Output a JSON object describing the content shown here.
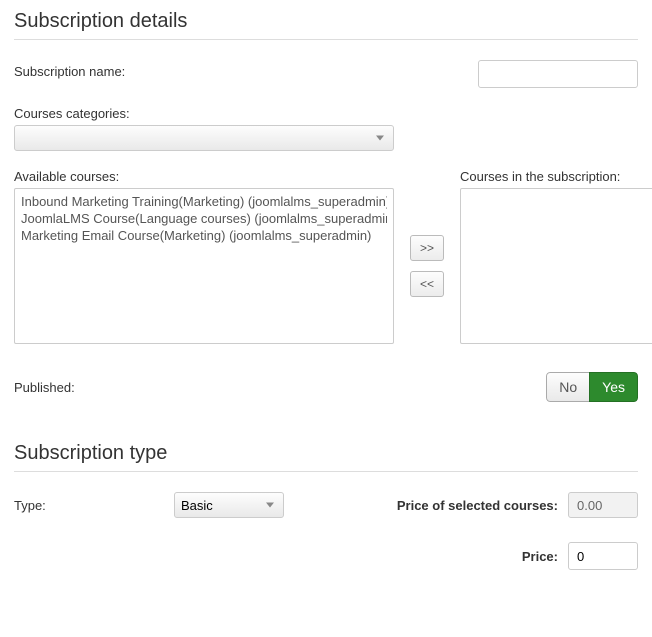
{
  "sections": {
    "details_title": "Subscription details",
    "type_title": "Subscription type"
  },
  "labels": {
    "subscription_name": "Subscription name:",
    "courses_categories": "Courses categories:",
    "available_courses": "Available courses:",
    "courses_in_subscription": "Courses in the subscription:",
    "published": "Published:",
    "type": "Type:",
    "price_selected": "Price of selected courses:",
    "price": "Price:"
  },
  "values": {
    "subscription_name": "",
    "categories_selected": "",
    "type_selected": "Basic",
    "price_selected_courses": "0.00",
    "price": "0",
    "published_no": "No",
    "published_yes": "Yes"
  },
  "available_courses": [
    "Inbound Marketing Training(Marketing) (joomlalms_superadmin)",
    "JoomlaLMS Course(Language courses) (joomlalms_superadmin)",
    "Marketing Email Course(Marketing) (joomlalms_superadmin)"
  ],
  "buttons": {
    "add": ">>",
    "remove": "<<"
  },
  "type_options": [
    "Basic"
  ]
}
